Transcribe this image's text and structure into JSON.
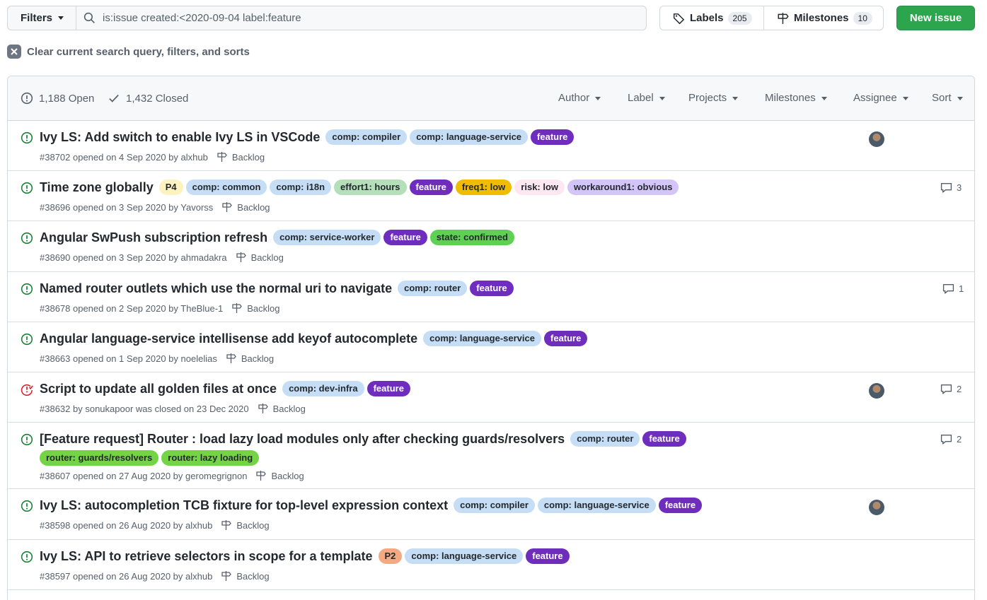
{
  "toolbar": {
    "filters_label": "Filters",
    "search_value": "is:issue created:<2020-09-04 label:feature",
    "labels_label": "Labels",
    "labels_count": "205",
    "milestones_label": "Milestones",
    "milestones_count": "10",
    "new_issue_label": "New issue"
  },
  "clear_text": "Clear current search query, filters, and sorts",
  "header": {
    "open_label": "1,188 Open",
    "closed_label": "1,432 Closed",
    "filters": [
      "Author",
      "Label",
      "Projects",
      "Milestones",
      "Assignee",
      "Sort"
    ]
  },
  "colors": {
    "green": "#2da44e",
    "open_icon": "#1a7f37",
    "closed_icon": "#cf222e"
  },
  "issues": [
    {
      "title": "Ivy LS: Add switch to enable Ivy LS in VSCode",
      "meta": "#38702 opened on 4 Sep 2020 by alxhub",
      "milestone": "Backlog",
      "state": "open",
      "labels": [
        {
          "text": "comp: compiler",
          "bg": "#c5def5",
          "fg": "#24292f"
        },
        {
          "text": "comp: language-service",
          "bg": "#c5def5",
          "fg": "#24292f"
        },
        {
          "text": "feature",
          "bg": "#6f2dbd",
          "fg": "#ffffff"
        }
      ],
      "comments": "",
      "avatar": true
    },
    {
      "title": "Time zone globally",
      "meta": "#38696 opened on 3 Sep 2020 by Yavorss",
      "milestone": "Backlog",
      "state": "open",
      "labels": [
        {
          "text": "P4",
          "bg": "#fef2c0",
          "fg": "#24292f"
        },
        {
          "text": "comp: common",
          "bg": "#c5def5",
          "fg": "#24292f"
        },
        {
          "text": "comp: i18n",
          "bg": "#c5def5",
          "fg": "#24292f"
        },
        {
          "text": "effort1: hours",
          "bg": "#b5dfb8",
          "fg": "#24292f"
        },
        {
          "text": "feature",
          "bg": "#6f2dbd",
          "fg": "#ffffff"
        },
        {
          "text": "freq1: low",
          "bg": "#f0bc00",
          "fg": "#24292f"
        },
        {
          "text": "risk: low",
          "bg": "#fde8f2",
          "fg": "#24292f"
        },
        {
          "text": "workaround1: obvious",
          "bg": "#d4c5f9",
          "fg": "#24292f"
        }
      ],
      "comments": "3",
      "avatar": false
    },
    {
      "title": "Angular SwPush subscription refresh",
      "meta": "#38690 opened on 3 Sep 2020 by ahmadakra",
      "milestone": "Backlog",
      "state": "open",
      "labels": [
        {
          "text": "comp: service-worker",
          "bg": "#c5def5",
          "fg": "#24292f"
        },
        {
          "text": "feature",
          "bg": "#6f2dbd",
          "fg": "#ffffff"
        },
        {
          "text": "state: confirmed",
          "bg": "#5ed153",
          "fg": "#24292f"
        }
      ],
      "comments": "",
      "avatar": false
    },
    {
      "title": "Named router outlets which use the normal uri to navigate",
      "meta": "#38678 opened on 2 Sep 2020 by TheBlue-1",
      "milestone": "Backlog",
      "state": "open",
      "labels": [
        {
          "text": "comp: router",
          "bg": "#c5def5",
          "fg": "#24292f"
        },
        {
          "text": "feature",
          "bg": "#6f2dbd",
          "fg": "#ffffff"
        }
      ],
      "comments": "1",
      "avatar": false
    },
    {
      "title": "Angular language-service intellisense add keyof autocomplete",
      "meta": "#38663 opened on 1 Sep 2020 by noelelias",
      "milestone": "Backlog",
      "state": "open",
      "labels": [
        {
          "text": "comp: language-service",
          "bg": "#c5def5",
          "fg": "#24292f"
        },
        {
          "text": "feature",
          "bg": "#6f2dbd",
          "fg": "#ffffff"
        }
      ],
      "comments": "",
      "avatar": false
    },
    {
      "title": "Script to update all golden files at once",
      "meta": "#38632 by sonukapoor was closed on 23 Dec 2020",
      "milestone": "Backlog",
      "state": "closed",
      "labels": [
        {
          "text": "comp: dev-infra",
          "bg": "#c5def5",
          "fg": "#24292f"
        },
        {
          "text": "feature",
          "bg": "#6f2dbd",
          "fg": "#ffffff"
        }
      ],
      "comments": "2",
      "avatar": true
    },
    {
      "title": "[Feature request] Router : load lazy load modules only after checking guards/resolvers",
      "meta": "#38607 opened on 27 Aug 2020 by geromegrignon",
      "milestone": "Backlog",
      "state": "open",
      "labels": [
        {
          "text": "comp: router",
          "bg": "#c5def5",
          "fg": "#24292f"
        },
        {
          "text": "feature",
          "bg": "#6f2dbd",
          "fg": "#ffffff"
        }
      ],
      "labels2": [
        {
          "text": "router: guards/resolvers",
          "bg": "#75d446",
          "fg": "#24292f"
        },
        {
          "text": "router: lazy loading",
          "bg": "#75d446",
          "fg": "#24292f"
        }
      ],
      "comments": "2",
      "avatar": false
    },
    {
      "title": "Ivy LS: autocompletion TCB fixture for top-level expression context",
      "meta": "#38598 opened on 26 Aug 2020 by alxhub",
      "milestone": "Backlog",
      "state": "open",
      "labels": [
        {
          "text": "comp: compiler",
          "bg": "#c5def5",
          "fg": "#24292f"
        },
        {
          "text": "comp: language-service",
          "bg": "#c5def5",
          "fg": "#24292f"
        },
        {
          "text": "feature",
          "bg": "#6f2dbd",
          "fg": "#ffffff"
        }
      ],
      "comments": "",
      "avatar": true
    },
    {
      "title": "Ivy LS: API to retrieve selectors in scope for a template",
      "meta": "#38597 opened on 26 Aug 2020 by alxhub",
      "milestone": "Backlog",
      "state": "open",
      "labels": [
        {
          "text": "P2",
          "bg": "#f4a983",
          "fg": "#24292f"
        },
        {
          "text": "comp: language-service",
          "bg": "#c5def5",
          "fg": "#24292f"
        },
        {
          "text": "feature",
          "bg": "#6f2dbd",
          "fg": "#ffffff"
        }
      ],
      "comments": "",
      "avatar": false
    }
  ]
}
